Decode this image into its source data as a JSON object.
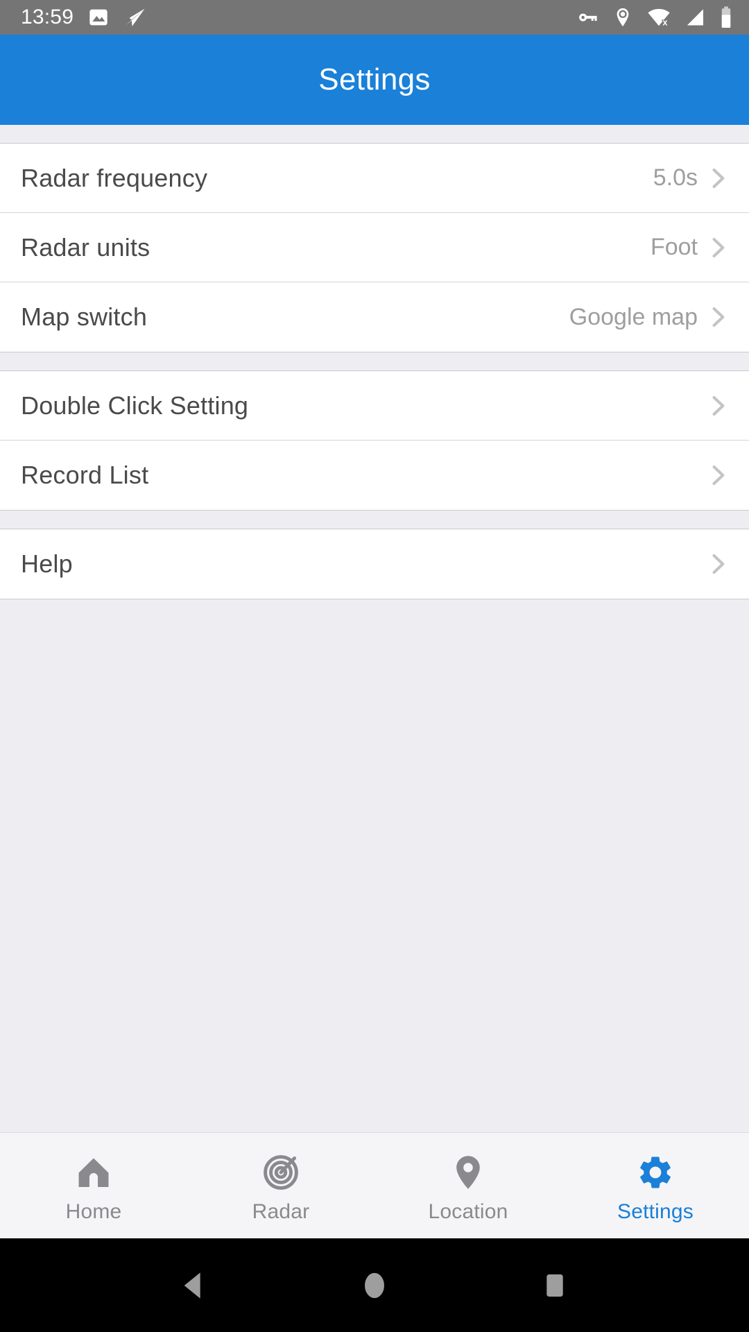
{
  "status_bar": {
    "time": "13:59",
    "left_icons": [
      "photo-icon",
      "send-icon"
    ],
    "right_icons": [
      "vpn-key-icon",
      "location-pin-icon",
      "wifi-off-icon",
      "cellular-signal-icon",
      "battery-icon"
    ],
    "background_color": "#757575",
    "foreground_color": "#ffffff"
  },
  "app_bar": {
    "title": "Settings",
    "background_color": "#1a80d8",
    "text_color": "#ffffff"
  },
  "settings": {
    "groups": [
      {
        "rows": [
          {
            "label": "Radar frequency",
            "value": "5.0s",
            "chevron": "chevron-right-icon"
          },
          {
            "label": "Radar units",
            "value": "Foot",
            "chevron": "chevron-right-icon"
          },
          {
            "label": "Map switch",
            "value": "Google map",
            "chevron": "chevron-right-icon"
          }
        ]
      },
      {
        "rows": [
          {
            "label": "Double Click Setting",
            "value": "",
            "chevron": "chevron-right-icon"
          },
          {
            "label": "Record List",
            "value": "",
            "chevron": "chevron-right-icon"
          }
        ]
      },
      {
        "rows": [
          {
            "label": "Help",
            "value": "",
            "chevron": "chevron-right-icon"
          }
        ]
      }
    ],
    "label_color": "#4a4a4a",
    "value_color": "#9e9e9e",
    "row_background": "#ffffff",
    "page_background": "#eeeef2"
  },
  "tab_bar": {
    "tabs": [
      {
        "label": "Home",
        "icon": "home-icon",
        "active": false
      },
      {
        "label": "Radar",
        "icon": "radar-target-icon",
        "active": false
      },
      {
        "label": "Location",
        "icon": "location-pin-icon",
        "active": false
      },
      {
        "label": "Settings",
        "icon": "gear-icon",
        "active": true
      }
    ],
    "active_color": "#1a80d8",
    "inactive_color": "#8a8a8e",
    "background_color": "#f5f5f7"
  },
  "nav_bar": {
    "buttons": [
      {
        "name": "back-button",
        "icon": "triangle-back-icon"
      },
      {
        "name": "home-button",
        "icon": "circle-home-icon"
      },
      {
        "name": "recents-button",
        "icon": "square-recents-icon"
      }
    ],
    "background_color": "#000000",
    "icon_color": "#9e9e9e"
  }
}
